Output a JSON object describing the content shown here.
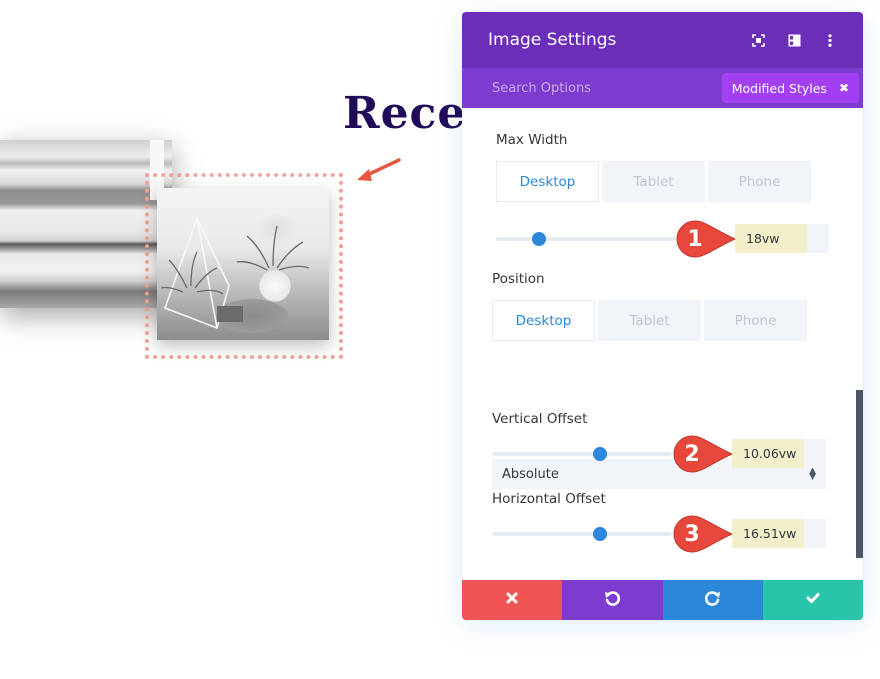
{
  "page": {
    "heading": "Rece"
  },
  "panel": {
    "title": "Image Settings",
    "header_icons": [
      "expand-icon",
      "split-view-icon",
      "more-options-icon"
    ],
    "search": {
      "placeholder": "Search Options",
      "value": ""
    },
    "filter_badge": {
      "label": "Modified Styles",
      "close_icon": "close-icon"
    },
    "fields": {
      "max_width": {
        "label": "Max Width",
        "tabs": [
          "Desktop",
          "Tablet",
          "Phone"
        ],
        "active_tab": "Desktop",
        "slider_fraction": 0.24,
        "value": "18vw",
        "callout_number": "1"
      },
      "position": {
        "label": "Position",
        "tabs": [
          "Desktop",
          "Tablet",
          "Phone"
        ],
        "active_tab": "Desktop",
        "selected": "Absolute"
      },
      "vertical_offset": {
        "label": "Vertical Offset",
        "slider_fraction": 0.6,
        "value": "10.06vw",
        "callout_number": "2"
      },
      "horizontal_offset": {
        "label": "Horizontal Offset",
        "slider_fraction": 0.6,
        "value": "16.51vw",
        "callout_number": "3"
      }
    },
    "footer": {
      "cancel": "close-icon",
      "undo": "undo-icon",
      "redo": "redo-icon",
      "save": "check-icon"
    }
  },
  "colors": {
    "header": "#6c2eb9",
    "search_bar": "#7d3bcf",
    "badge": "#a23ff1",
    "accent_blue": "#2b87da",
    "value_highlight": "#f3efcb",
    "callout_red": "#e8473c",
    "cancel": "#ef5555",
    "undo": "#7e3bd0",
    "redo": "#2b87da",
    "save": "#29c4a9"
  }
}
